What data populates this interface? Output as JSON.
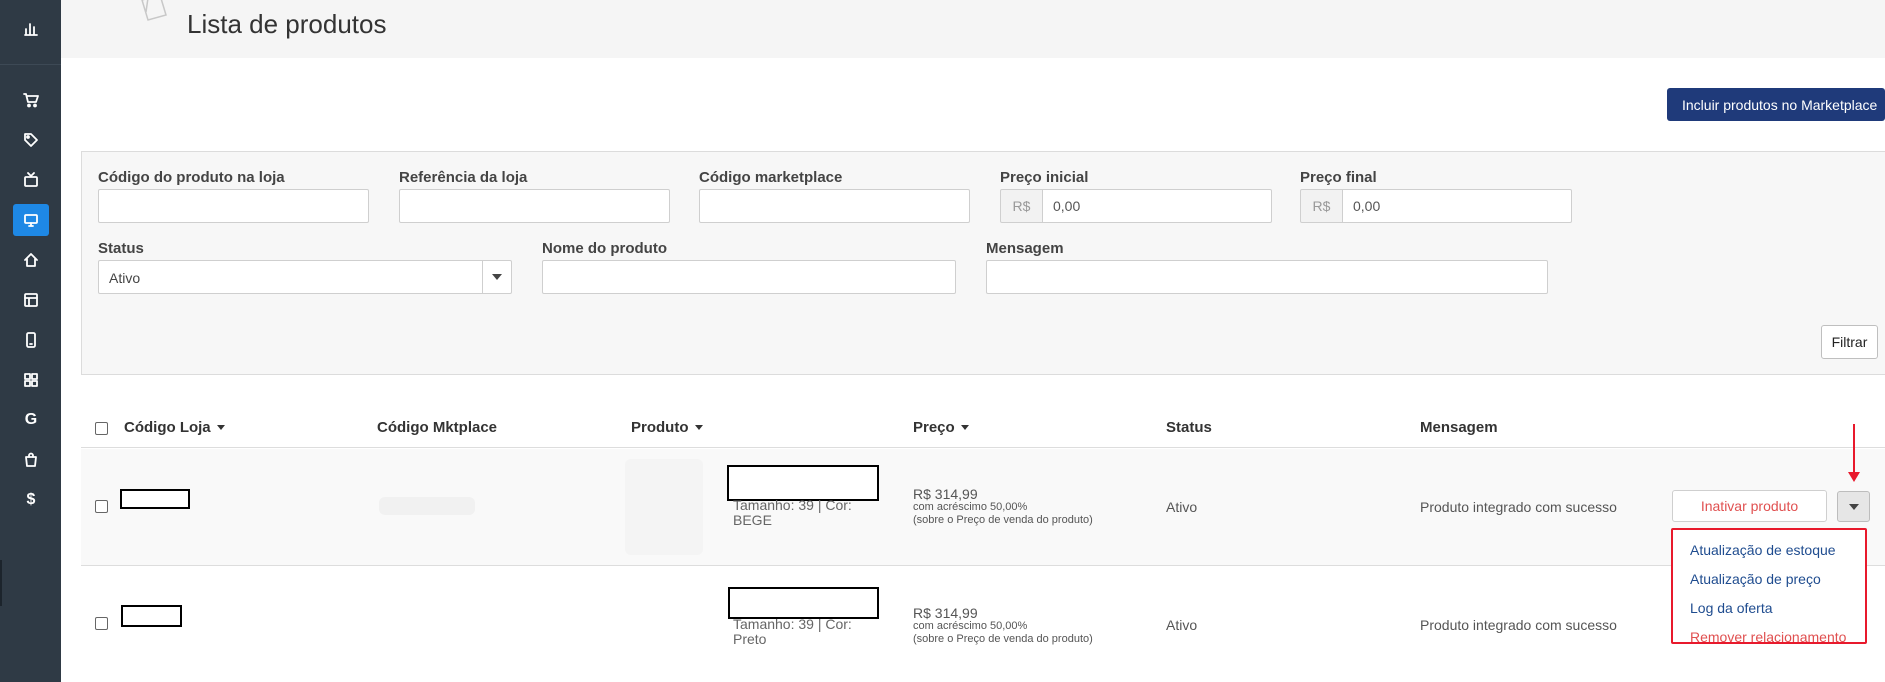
{
  "page": {
    "title": "Lista de produtos"
  },
  "sidebar": {
    "items": [
      {
        "icon": "bar-chart-icon"
      },
      {
        "icon": "cart-icon"
      },
      {
        "icon": "tag-icon"
      },
      {
        "icon": "tv-icon"
      },
      {
        "icon": "monitor-icon",
        "active": true
      },
      {
        "icon": "home-icon"
      },
      {
        "icon": "layout-icon"
      },
      {
        "icon": "mobile-icon"
      },
      {
        "icon": "grid-icon"
      },
      {
        "icon": "google-icon",
        "glyph": "G"
      },
      {
        "icon": "bag-icon"
      },
      {
        "icon": "dollar-icon",
        "glyph": "$"
      }
    ]
  },
  "actions": {
    "include_label": "Incluir produtos no Marketplace"
  },
  "filters": {
    "codigo_loja_label": "Código do produto na loja",
    "referencia_label": "Referência da loja",
    "codigo_marketplace_label": "Código marketplace",
    "preco_inicial_label": "Preço inicial",
    "preco_final_label": "Preço final",
    "currency_addon": "R$",
    "preco_inicial_value": "0,00",
    "preco_final_value": "0,00",
    "status_label": "Status",
    "status_value": "Ativo",
    "nome_label": "Nome do produto",
    "mensagem_label": "Mensagem",
    "filter_button": "Filtrar"
  },
  "table": {
    "headers": {
      "codigo_loja": "Código Loja",
      "codigo_mktplace": "Código Mktplace",
      "produto": "Produto",
      "preco": "Preço",
      "status": "Status",
      "mensagem": "Mensagem"
    },
    "rows": [
      {
        "variant": "Tamanho: 39 | Cor: BEGE",
        "price": "R$ 314,99",
        "price_note1": "com acréscimo 50,00%",
        "price_note2": "(sobre o Preço de venda do produto)",
        "status": "Ativo",
        "message": "Produto integrado com sucesso"
      },
      {
        "variant": "Tamanho: 39 | Cor: Preto",
        "price": "R$ 314,99",
        "price_note1": "com acréscimo 50,00%",
        "price_note2": "(sobre o Preço de venda do produto)",
        "status": "Ativo",
        "message": "Produto integrado com sucesso"
      }
    ]
  },
  "row_actions": {
    "inativar": "Inativar produto",
    "menu": [
      {
        "label": "Atualização de estoque"
      },
      {
        "label": "Atualização de preço"
      },
      {
        "label": "Log da oferta"
      },
      {
        "label": "Remover relacionamento",
        "danger": true
      }
    ]
  },
  "colors": {
    "primary": "#1f3a7a",
    "sidebar": "#2f3a45",
    "active": "#1e88e5",
    "highlight": "#e8192c",
    "danger": "#e05050",
    "link": "#1f4c8f"
  }
}
